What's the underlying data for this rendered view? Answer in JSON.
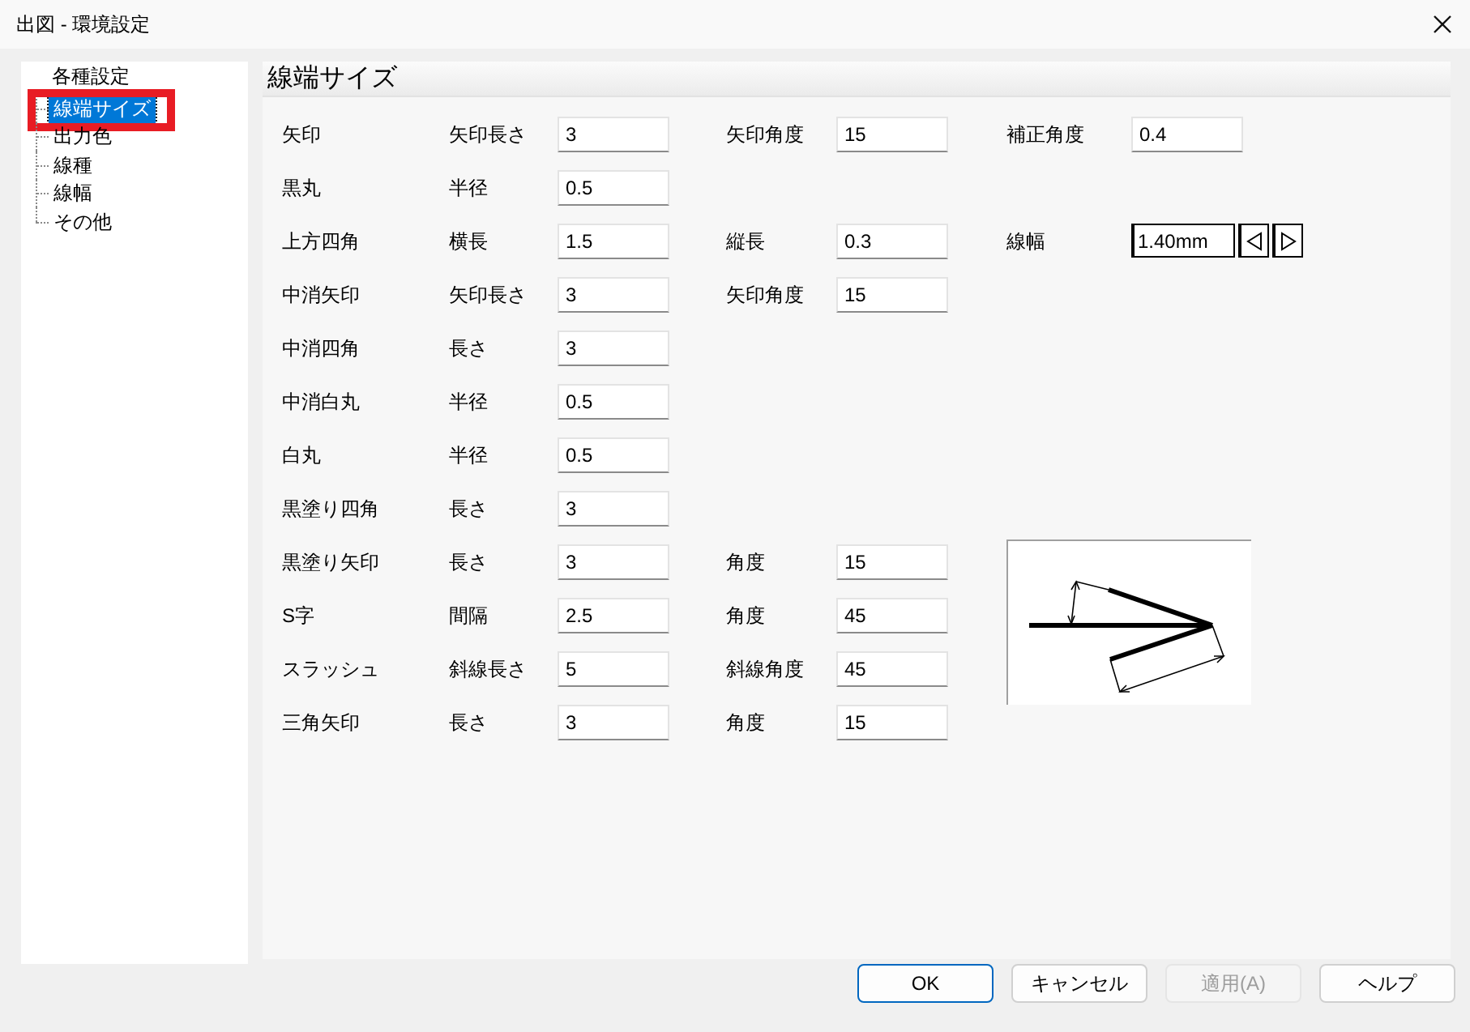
{
  "window": {
    "title": "出図 - 環境設定"
  },
  "tree": {
    "items": [
      {
        "label": "各種設定",
        "selected": false,
        "highlighted": false,
        "children": [
          {
            "label": "線端サイズ",
            "selected": true,
            "highlighted": true
          },
          {
            "label": "出力色",
            "selected": false,
            "highlighted": false
          },
          {
            "label": "線種",
            "selected": false,
            "highlighted": false
          },
          {
            "label": "線幅",
            "selected": false,
            "highlighted": false
          },
          {
            "label": "その他",
            "selected": false,
            "highlighted": false
          }
        ]
      }
    ]
  },
  "panel": {
    "title": "線端サイズ",
    "rows": [
      {
        "name": "矢印",
        "fields": [
          {
            "kind": "text",
            "label": "矢印長さ",
            "value": "3"
          },
          {
            "kind": "text",
            "label": "矢印角度",
            "value": "15"
          },
          {
            "kind": "text",
            "label": "補正角度",
            "value": "0.4"
          }
        ]
      },
      {
        "name": "黒丸",
        "fields": [
          {
            "kind": "text",
            "label": "半径",
            "value": "0.5"
          }
        ]
      },
      {
        "name": "上方四角",
        "fields": [
          {
            "kind": "text",
            "label": "横長",
            "value": "1.5"
          },
          {
            "kind": "text",
            "label": "縦長",
            "value": "0.3"
          },
          {
            "kind": "stepper",
            "label": "線幅",
            "value": "1.40mm"
          }
        ]
      },
      {
        "name": "中消矢印",
        "fields": [
          {
            "kind": "text",
            "label": "矢印長さ",
            "value": "3"
          },
          {
            "kind": "text",
            "label": "矢印角度",
            "value": "15"
          }
        ]
      },
      {
        "name": "中消四角",
        "fields": [
          {
            "kind": "text",
            "label": "長さ",
            "value": "3"
          }
        ]
      },
      {
        "name": "中消白丸",
        "fields": [
          {
            "kind": "text",
            "label": "半径",
            "value": "0.5"
          }
        ]
      },
      {
        "name": "白丸",
        "fields": [
          {
            "kind": "text",
            "label": "半径",
            "value": "0.5"
          }
        ]
      },
      {
        "name": "黒塗り四角",
        "fields": [
          {
            "kind": "text",
            "label": "長さ",
            "value": "3"
          }
        ]
      },
      {
        "name": "黒塗り矢印",
        "fields": [
          {
            "kind": "text",
            "label": "長さ",
            "value": "3"
          },
          {
            "kind": "text",
            "label": "角度",
            "value": "15"
          }
        ]
      },
      {
        "name": "S字",
        "fields": [
          {
            "kind": "text",
            "label": "間隔",
            "value": "2.5"
          },
          {
            "kind": "text",
            "label": "角度",
            "value": "45"
          }
        ]
      },
      {
        "name": "スラッシュ",
        "fields": [
          {
            "kind": "text",
            "label": "斜線長さ",
            "value": "5"
          },
          {
            "kind": "text",
            "label": "斜線角度",
            "value": "45"
          }
        ]
      },
      {
        "name": "三角矢印",
        "fields": [
          {
            "kind": "text",
            "label": "長さ",
            "value": "3"
          },
          {
            "kind": "text",
            "label": "角度",
            "value": "15"
          }
        ]
      }
    ]
  },
  "buttons": [
    {
      "label": "OK",
      "default": true,
      "disabled": false
    },
    {
      "label": "キャンセル",
      "default": false,
      "disabled": false
    },
    {
      "label": "適用(A)",
      "default": false,
      "disabled": true
    },
    {
      "label": "ヘルプ",
      "default": false,
      "disabled": false
    }
  ]
}
